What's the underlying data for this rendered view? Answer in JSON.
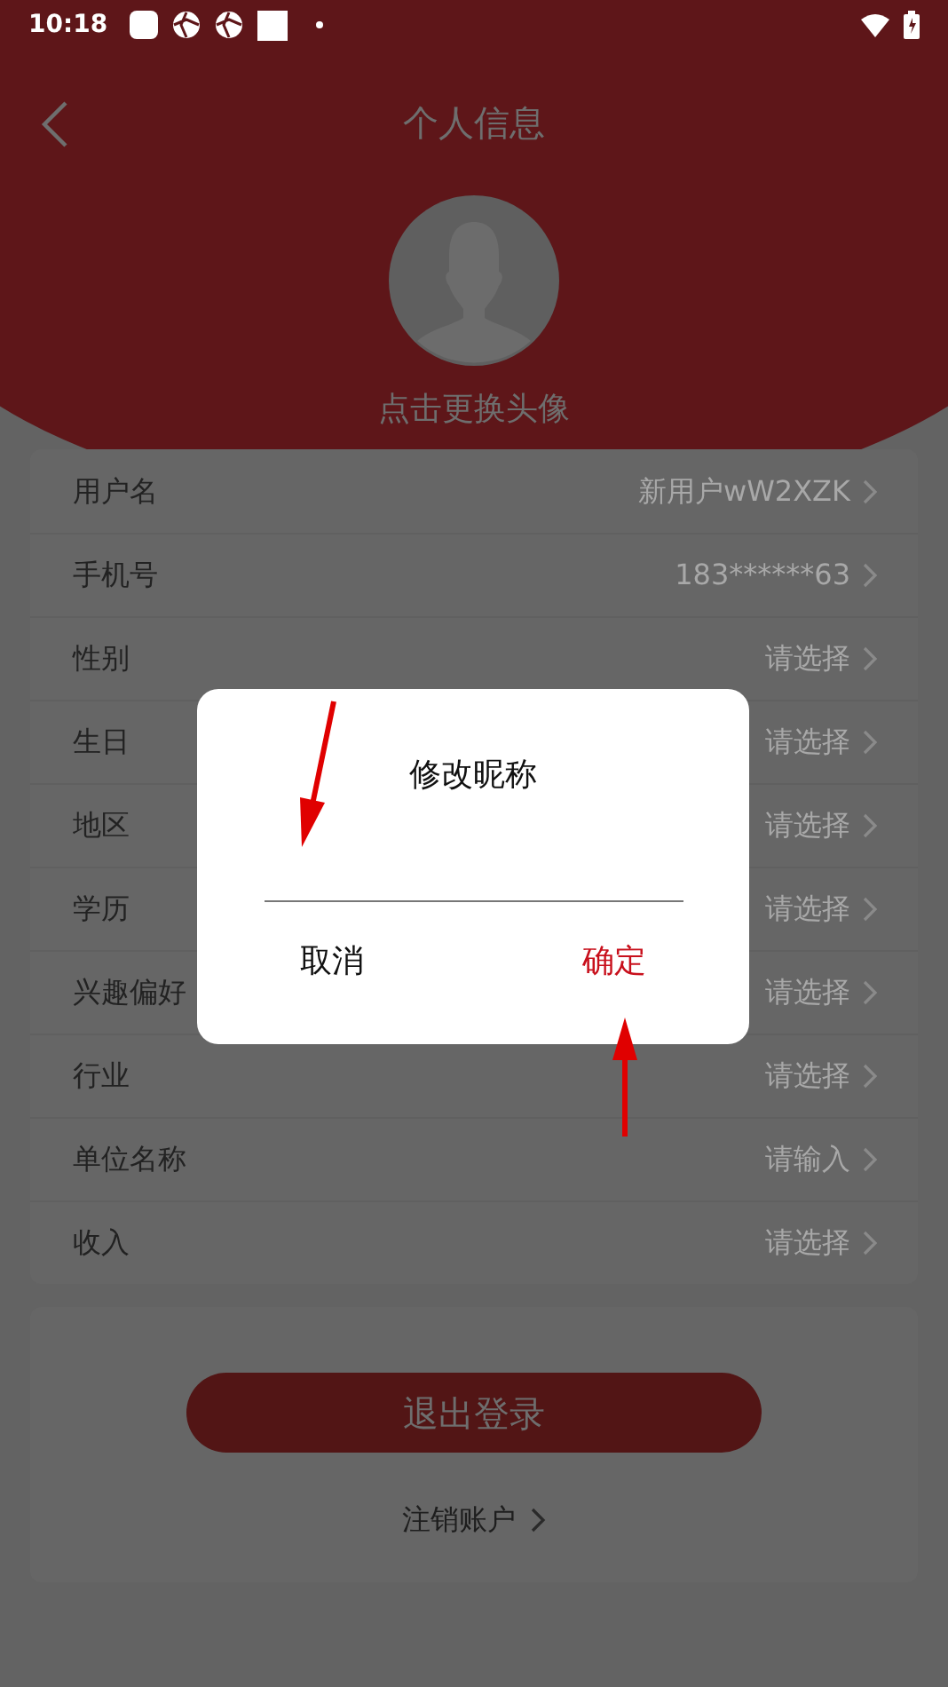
{
  "status_bar": {
    "time": "10:18"
  },
  "header": {
    "title": "个人信息"
  },
  "avatar": {
    "caption": "点击更换头像"
  },
  "fields": [
    {
      "label": "用户名",
      "value": "新用户wW2XZK"
    },
    {
      "label": "手机号",
      "value": "183******63"
    },
    {
      "label": "性别",
      "value": "请选择"
    },
    {
      "label": "生日",
      "value": "请选择"
    },
    {
      "label": "地区",
      "value": "请选择"
    },
    {
      "label": "学历",
      "value": "请选择"
    },
    {
      "label": "兴趣偏好",
      "value": "请选择"
    },
    {
      "label": "行业",
      "value": "请选择"
    },
    {
      "label": "单位名称",
      "value": "请输入"
    },
    {
      "label": "收入",
      "value": "请选择"
    }
  ],
  "logout_button": "退出登录",
  "delete_account_link": "注销账户",
  "dialog": {
    "title": "修改昵称",
    "cancel": "取消",
    "confirm": "确定"
  }
}
